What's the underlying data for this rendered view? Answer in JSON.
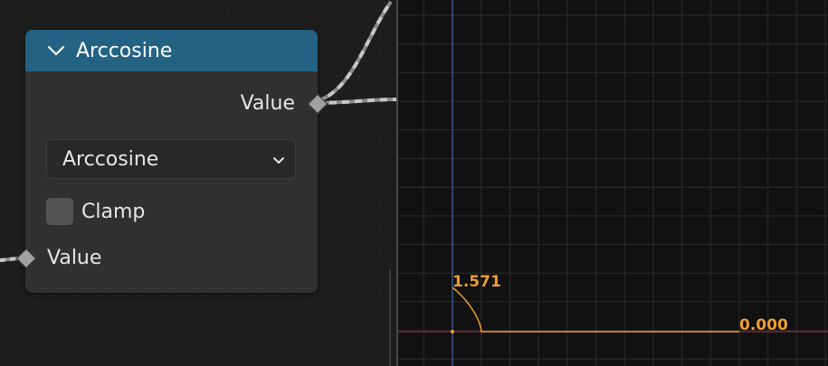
{
  "node": {
    "title": "Arccosine",
    "output_socket_label": "Value",
    "operation_dropdown_value": "Arccosine",
    "clamp_label": "Clamp",
    "clamp_checked": false,
    "input_socket_label": "Value",
    "header_color": "#246283"
  },
  "graph": {
    "start_value_label": "1.571",
    "end_value_label": "0.000",
    "curve_color": "#f0a030",
    "axis_color": "#4a78c8",
    "baseline_color": "#a0304a"
  }
}
